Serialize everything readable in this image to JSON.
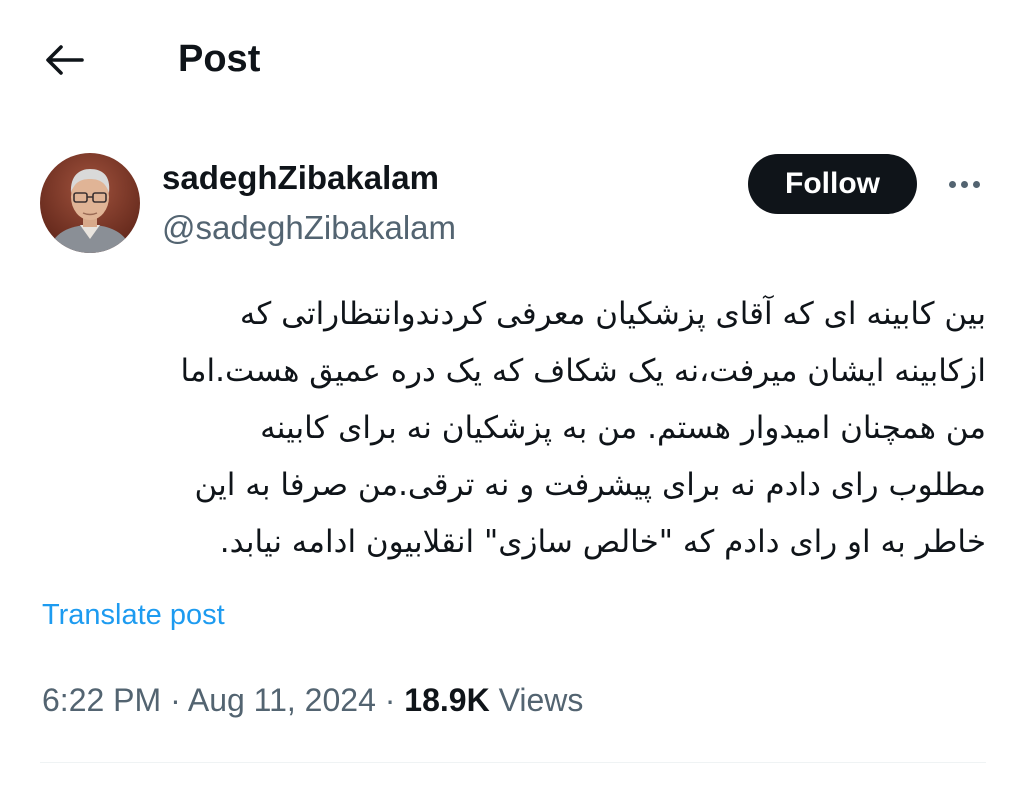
{
  "header": {
    "title": "Post",
    "back_icon": "arrow-left-icon"
  },
  "author": {
    "display_name": "sadeghZibakalam",
    "handle": "@sadeghZibakalam",
    "follow_label": "Follow",
    "more_icon": "more-horizontal-icon"
  },
  "post": {
    "lines": [
      "بین کابینه ای که آقای پزشکیان معرفی کردندوانتظاراتی که",
      "ازکابینه ایشان میرفت،نه یک شکاف که یک دره عمیق هست.اما",
      "من همچنان امیدوار هستم. من به پزشکیان نه برای کابینه",
      "مطلوب رای دادم نه برای پیشرفت و نه ترقی.من صرفا به این",
      "خاطر به او رای دادم  که \"خالص سازی\" انقلابیون ادامه نیابد."
    ],
    "translate_label": "Translate post"
  },
  "meta": {
    "time": "6:22 PM",
    "separator": "·",
    "date": "Aug 11, 2024",
    "views_count": "18.9K",
    "views_label": "Views"
  },
  "colors": {
    "text_primary": "#0f1419",
    "text_secondary": "#536471",
    "link": "#1d9bf0",
    "follow_bg": "#0f1419",
    "divider": "#eff3f4"
  }
}
